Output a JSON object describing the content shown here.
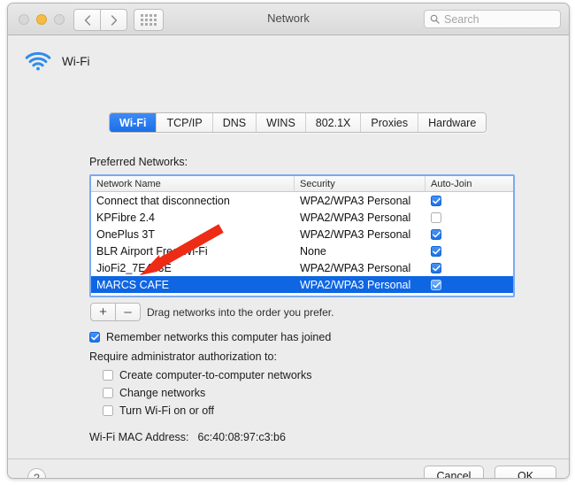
{
  "window": {
    "title": "Network",
    "traffic_lights": [
      "close",
      "minimize",
      "maximize"
    ],
    "nav_back_icon": "chevron-left-icon",
    "nav_forward_icon": "chevron-right-icon",
    "grid_icon": "show-all-grid-icon"
  },
  "search": {
    "placeholder": "Search",
    "value": "",
    "icon": "search-icon"
  },
  "interface": {
    "icon": "wifi-icon",
    "name": "Wi-Fi"
  },
  "tabs": [
    {
      "label": "Wi-Fi",
      "active": true
    },
    {
      "label": "TCP/IP",
      "active": false
    },
    {
      "label": "DNS",
      "active": false
    },
    {
      "label": "WINS",
      "active": false
    },
    {
      "label": "802.1X",
      "active": false
    },
    {
      "label": "Proxies",
      "active": false
    },
    {
      "label": "Hardware",
      "active": false
    }
  ],
  "preferred": {
    "label": "Preferred Networks:",
    "columns": [
      "Network Name",
      "Security",
      "Auto-Join"
    ],
    "rows": [
      {
        "name": "Connect that disconnection",
        "security": "WPA2/WPA3 Personal",
        "auto_join": true,
        "selected": false
      },
      {
        "name": "KPFibre 2.4",
        "security": "WPA2/WPA3 Personal",
        "auto_join": false,
        "selected": false
      },
      {
        "name": "OnePlus 3T",
        "security": "WPA2/WPA3 Personal",
        "auto_join": true,
        "selected": false
      },
      {
        "name": "BLR Airport Free Wi-Fi",
        "security": "None",
        "auto_join": true,
        "selected": false
      },
      {
        "name": "JioFi2_7E453E",
        "security": "WPA2/WPA3 Personal",
        "auto_join": true,
        "selected": false
      },
      {
        "name": "MARCS CAFE",
        "security": "WPA2/WPA3 Personal",
        "auto_join": true,
        "selected": true
      },
      {
        "name": "",
        "security": "",
        "auto_join": true,
        "selected": false
      }
    ],
    "add_label": "+",
    "remove_label": "–",
    "drag_hint": "Drag networks into the order you prefer."
  },
  "options": {
    "remember": {
      "label": "Remember networks this computer has joined",
      "checked": true
    },
    "require_label": "Require administrator authorization to:",
    "items": [
      {
        "label": "Create computer-to-computer networks",
        "checked": false
      },
      {
        "label": "Change networks",
        "checked": false
      },
      {
        "label": "Turn Wi-Fi on or off",
        "checked": false
      }
    ]
  },
  "mac": {
    "label": "Wi-Fi MAC Address:",
    "value": "6c:40:08:97:c3:b6"
  },
  "footer": {
    "help_label": "?",
    "cancel_label": "Cancel",
    "ok_label": "OK"
  },
  "annotation": {
    "type": "arrow",
    "color": "#ee2b15",
    "points_to": "remove-network-button"
  },
  "colors": {
    "accent": "#0e66e3",
    "tab_active": "#1c6fe8",
    "annotation_red": "#ee2b15",
    "wifi_blue": "#2f8ceb"
  }
}
